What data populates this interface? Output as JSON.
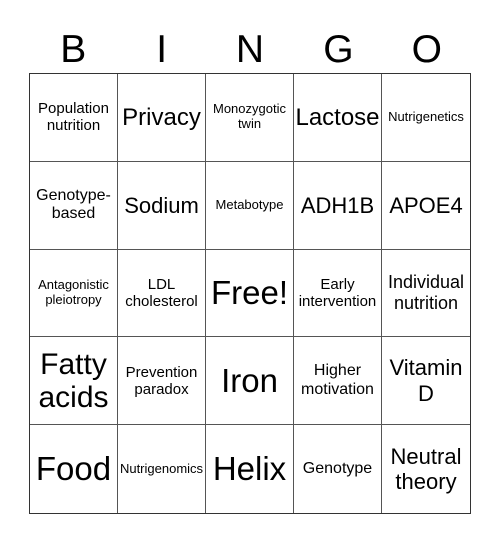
{
  "header": [
    "B",
    "I",
    "N",
    "G",
    "O"
  ],
  "cells": [
    [
      "Population nutrition",
      "Privacy",
      "Monozygotic twin",
      "Lactose",
      "Nutrigenetics"
    ],
    [
      "Genotype-based",
      "Sodium",
      "Metabotype",
      "ADH1B",
      "APOE4"
    ],
    [
      "Antagonistic pleiotropy",
      "LDL cholesterol",
      "Free!",
      "Early intervention",
      "Individual nutrition"
    ],
    [
      "Fatty acids",
      "Prevention paradox",
      "Iron",
      "Higher motivation",
      "Vitamin D"
    ],
    [
      "Food",
      "Nutrigenomics",
      "Helix",
      "Genotype",
      "Neutral theory"
    ]
  ]
}
